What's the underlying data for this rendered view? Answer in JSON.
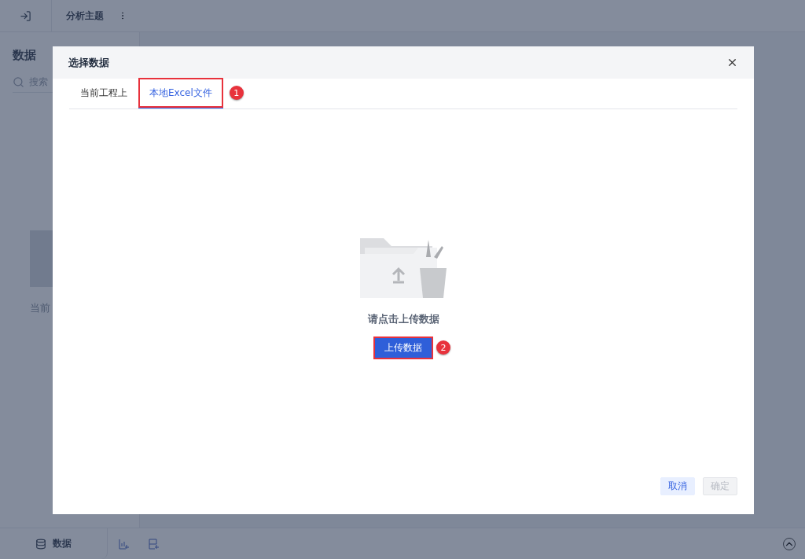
{
  "topbar": {
    "title": "分析主题"
  },
  "sidebar": {
    "title": "数据",
    "search_placeholder": "搜索",
    "empty_text": "当前"
  },
  "bottom_bar": {
    "tabs": [
      {
        "label": "数据",
        "selected": true
      }
    ]
  },
  "dialog": {
    "title": "选择数据",
    "tabs": [
      {
        "label": "当前工程上",
        "selected": false
      },
      {
        "label": "本地Excel文件",
        "selected": true,
        "callout": "1"
      }
    ],
    "empty_message": "请点击上传数据",
    "upload_button": {
      "label": "上传数据",
      "callout": "2"
    },
    "buttons": [
      {
        "label": "取消",
        "kind": "secondary",
        "disabled": false
      },
      {
        "label": "确定",
        "kind": "primary",
        "disabled": true
      }
    ]
  }
}
